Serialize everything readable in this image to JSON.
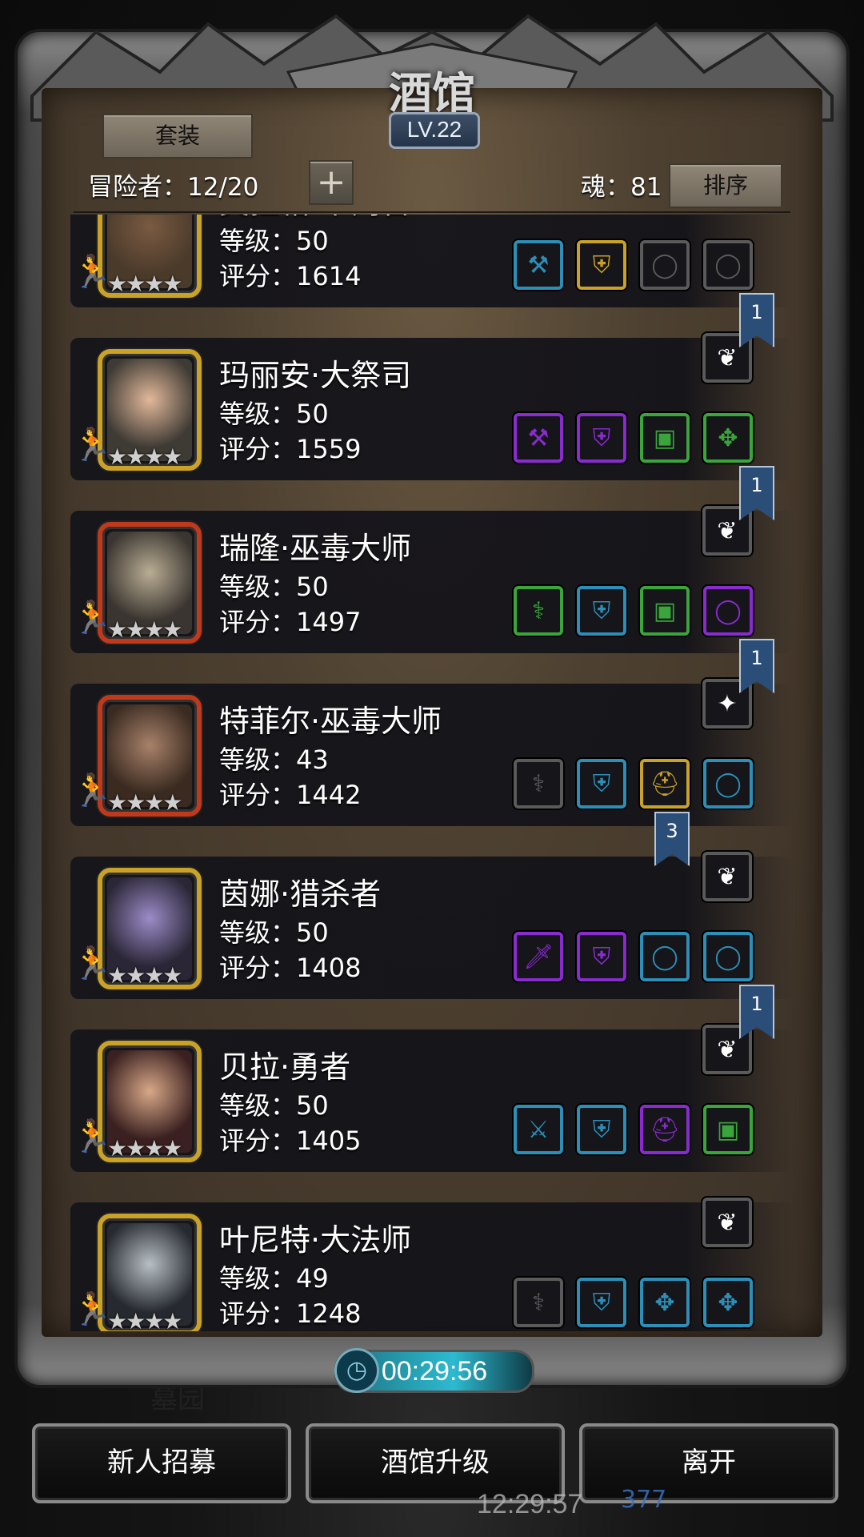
{
  "header": {
    "title": "酒馆",
    "level": "LV.22",
    "set_button": "套装",
    "adventurers": "冒险者：12/20",
    "add_button": "+",
    "souls": "魂：81",
    "sort_button": "排序"
  },
  "heroes": [
    {
      "name": "奥拉格·审判官",
      "level": "等级：50",
      "score": "评分：1614",
      "stars": "★★★★",
      "frame": "#c9a227",
      "portrait_bg": "#4a3a2a",
      "face": "#7a5a42",
      "top_slot": {
        "icon": "feather-icon",
        "glyph": "❦",
        "border": "#5a5a5a"
      },
      "slots": [
        {
          "icon": "hammer-icon",
          "glyph": "⚒",
          "border": "#2c8fb8"
        },
        {
          "icon": "armor-icon",
          "glyph": "⛨",
          "border": "#c9a227"
        },
        {
          "icon": "ring-icon",
          "glyph": "◯",
          "border": "#5a5a5a"
        },
        {
          "icon": "ring-icon",
          "glyph": "◯",
          "border": "#5a5a5a"
        }
      ]
    },
    {
      "name": "玛丽安·大祭司",
      "level": "等级：50",
      "score": "评分：1559",
      "stars": "★★★★",
      "frame": "#c9a227",
      "portrait_bg": "#3e3a34",
      "face": "#e2b89a",
      "top_slot": {
        "icon": "feather-icon",
        "glyph": "❦",
        "border": "#5a5a5a"
      },
      "slots": [
        {
          "icon": "hammer-icon",
          "glyph": "⚒",
          "border": "#8a2bd0"
        },
        {
          "icon": "armor-icon",
          "glyph": "⛨",
          "border": "#8a2bd0"
        },
        {
          "icon": "chest-icon",
          "glyph": "▣",
          "border": "#3aa53a"
        },
        {
          "icon": "amulet-icon",
          "glyph": "✥",
          "border": "#3aa53a"
        }
      ],
      "ribbon": "1"
    },
    {
      "name": "瑞隆·巫毒大师",
      "level": "等级：50",
      "score": "评分：1497",
      "stars": "★★★★",
      "frame": "#c0391b",
      "portrait_bg": "#3a3530",
      "face": "#b9ad94",
      "top_slot": {
        "icon": "feather-icon",
        "glyph": "❦",
        "border": "#5a5a5a"
      },
      "slots": [
        {
          "icon": "staff-icon",
          "glyph": "⚕",
          "border": "#3aa53a"
        },
        {
          "icon": "robe-icon",
          "glyph": "⛨",
          "border": "#2c8fb8"
        },
        {
          "icon": "chest-icon",
          "glyph": "▣",
          "border": "#3aa53a"
        },
        {
          "icon": "ring-icon",
          "glyph": "◯",
          "border": "#8a2bd0"
        }
      ],
      "ribbon": "1"
    },
    {
      "name": "特菲尔·巫毒大师",
      "level": "等级：43",
      "score": "评分：1442",
      "stars": "★★★★",
      "frame": "#c0391b",
      "portrait_bg": "#3a2a20",
      "face": "#a8826a",
      "top_slot": {
        "icon": "crystal-icon",
        "glyph": "✦",
        "border": "#5a5a5a"
      },
      "slots": [
        {
          "icon": "staff-icon",
          "glyph": "⚕",
          "border": "#5a5a5a"
        },
        {
          "icon": "armor-icon",
          "glyph": "⛨",
          "border": "#2c8fb8"
        },
        {
          "icon": "helmet-icon",
          "glyph": "⛑",
          "border": "#c9a227"
        },
        {
          "icon": "ring-icon",
          "glyph": "◯",
          "border": "#2c8fb8"
        }
      ],
      "ribbon": "1"
    },
    {
      "name": "茵娜·猎杀者",
      "level": "等级：50",
      "score": "评分：1408",
      "stars": "★★★★",
      "frame": "#c9a227",
      "portrait_bg": "#2a2636",
      "face": "#9c8cc8",
      "top_slot": {
        "icon": "feather-icon",
        "glyph": "❦",
        "border": "#5a5a5a"
      },
      "slots": [
        {
          "icon": "dagger-icon",
          "glyph": "🗡",
          "border": "#8a2bd0"
        },
        {
          "icon": "armor-icon",
          "glyph": "⛨",
          "border": "#8a2bd0"
        },
        {
          "icon": "ring-icon",
          "glyph": "◯",
          "border": "#2c8fb8"
        },
        {
          "icon": "ring-icon",
          "glyph": "◯",
          "border": "#2c8fb8"
        }
      ],
      "ribbon": "3"
    },
    {
      "name": "贝拉·勇者",
      "level": "等级：50",
      "score": "评分：1405",
      "stars": "★★★★",
      "frame": "#c9a227",
      "portrait_bg": "#3a2020",
      "face": "#d8a888",
      "top_slot": {
        "icon": "feather-icon",
        "glyph": "❦",
        "border": "#5a5a5a"
      },
      "slots": [
        {
          "icon": "axe-icon",
          "glyph": "⚔",
          "border": "#2c8fb8"
        },
        {
          "icon": "armor-icon",
          "glyph": "⛨",
          "border": "#2c8fb8"
        },
        {
          "icon": "helmet-icon",
          "glyph": "⛑",
          "border": "#8a2bd0"
        },
        {
          "icon": "chest-icon",
          "glyph": "▣",
          "border": "#3aa53a"
        }
      ],
      "ribbon": "1"
    },
    {
      "name": "叶尼特·大法师",
      "level": "等级：49",
      "score": "评分：1248",
      "stars": "★★★★",
      "frame": "#c9a227",
      "portrait_bg": "#262a30",
      "face": "#b8c0c4",
      "top_slot": {
        "icon": "feather-icon",
        "glyph": "❦",
        "border": "#5a5a5a"
      },
      "slots": [
        {
          "icon": "staff-icon",
          "glyph": "⚕",
          "border": "#5a5a5a"
        },
        {
          "icon": "armor-icon",
          "glyph": "⛨",
          "border": "#2c8fb8"
        },
        {
          "icon": "amulet-icon",
          "glyph": "✥",
          "border": "#2c8fb8"
        },
        {
          "icon": "amulet-icon",
          "glyph": "✥",
          "border": "#2c8fb8"
        }
      ]
    }
  ],
  "footer": {
    "timer": "00:29:56",
    "recruit_button": "新人招募",
    "upgrade_button": "酒馆升级",
    "leave_button": "离开",
    "bg_clock": "12:29:57",
    "bg_count": "377",
    "bg_label": "墓园"
  }
}
